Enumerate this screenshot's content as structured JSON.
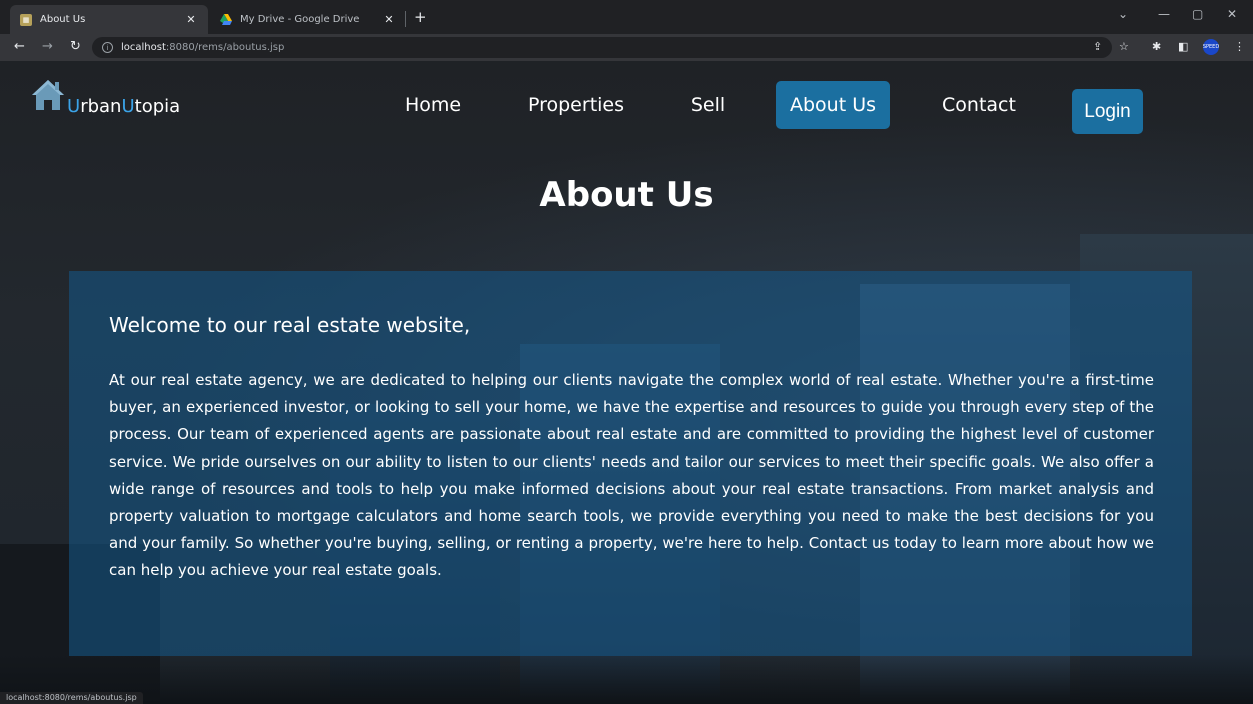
{
  "browser": {
    "tabs": [
      {
        "title": "About Us",
        "active": true
      },
      {
        "title": "My Drive - Google Drive",
        "active": false
      }
    ],
    "address": {
      "host": "localhost",
      "path": ":8080/rems/aboutus.jsp"
    },
    "status_url": "localhost:8080/rems/aboutus.jsp",
    "profile_label": "SPEED"
  },
  "site": {
    "brand_first": "U",
    "brand_first_rest": "rban",
    "brand_second": "U",
    "brand_second_rest": "topia",
    "nav": [
      "Home",
      "Properties",
      "Sell",
      "About Us",
      "Contact"
    ],
    "active_nav": "About Us",
    "login_label": "Login",
    "colors": {
      "accent": "#1b6fa0",
      "brand_accent": "#3ba3e8"
    }
  },
  "main": {
    "title": "About Us",
    "welcome": "Welcome to our real estate website,",
    "body": "At our real estate agency, we are dedicated to helping our clients navigate the complex world of real estate. Whether you're a first-time buyer, an experienced investor, or looking to sell your home, we have the expertise and resources to guide you through every step of the process. Our team of experienced agents are passionate about real estate and are committed to providing the highest level of customer service. We pride ourselves on our ability to listen to our clients' needs and tailor our services to meet their specific goals. We also offer a wide range of resources and tools to help you make informed decisions about your real estate transactions. From market analysis and property valuation to mortgage calculators and home search tools, we provide everything you need to make the best decisions for you and your family. So whether you're buying, selling, or renting a property, we're here to help. Contact us today to learn more about how we can help you achieve your real estate goals."
  }
}
